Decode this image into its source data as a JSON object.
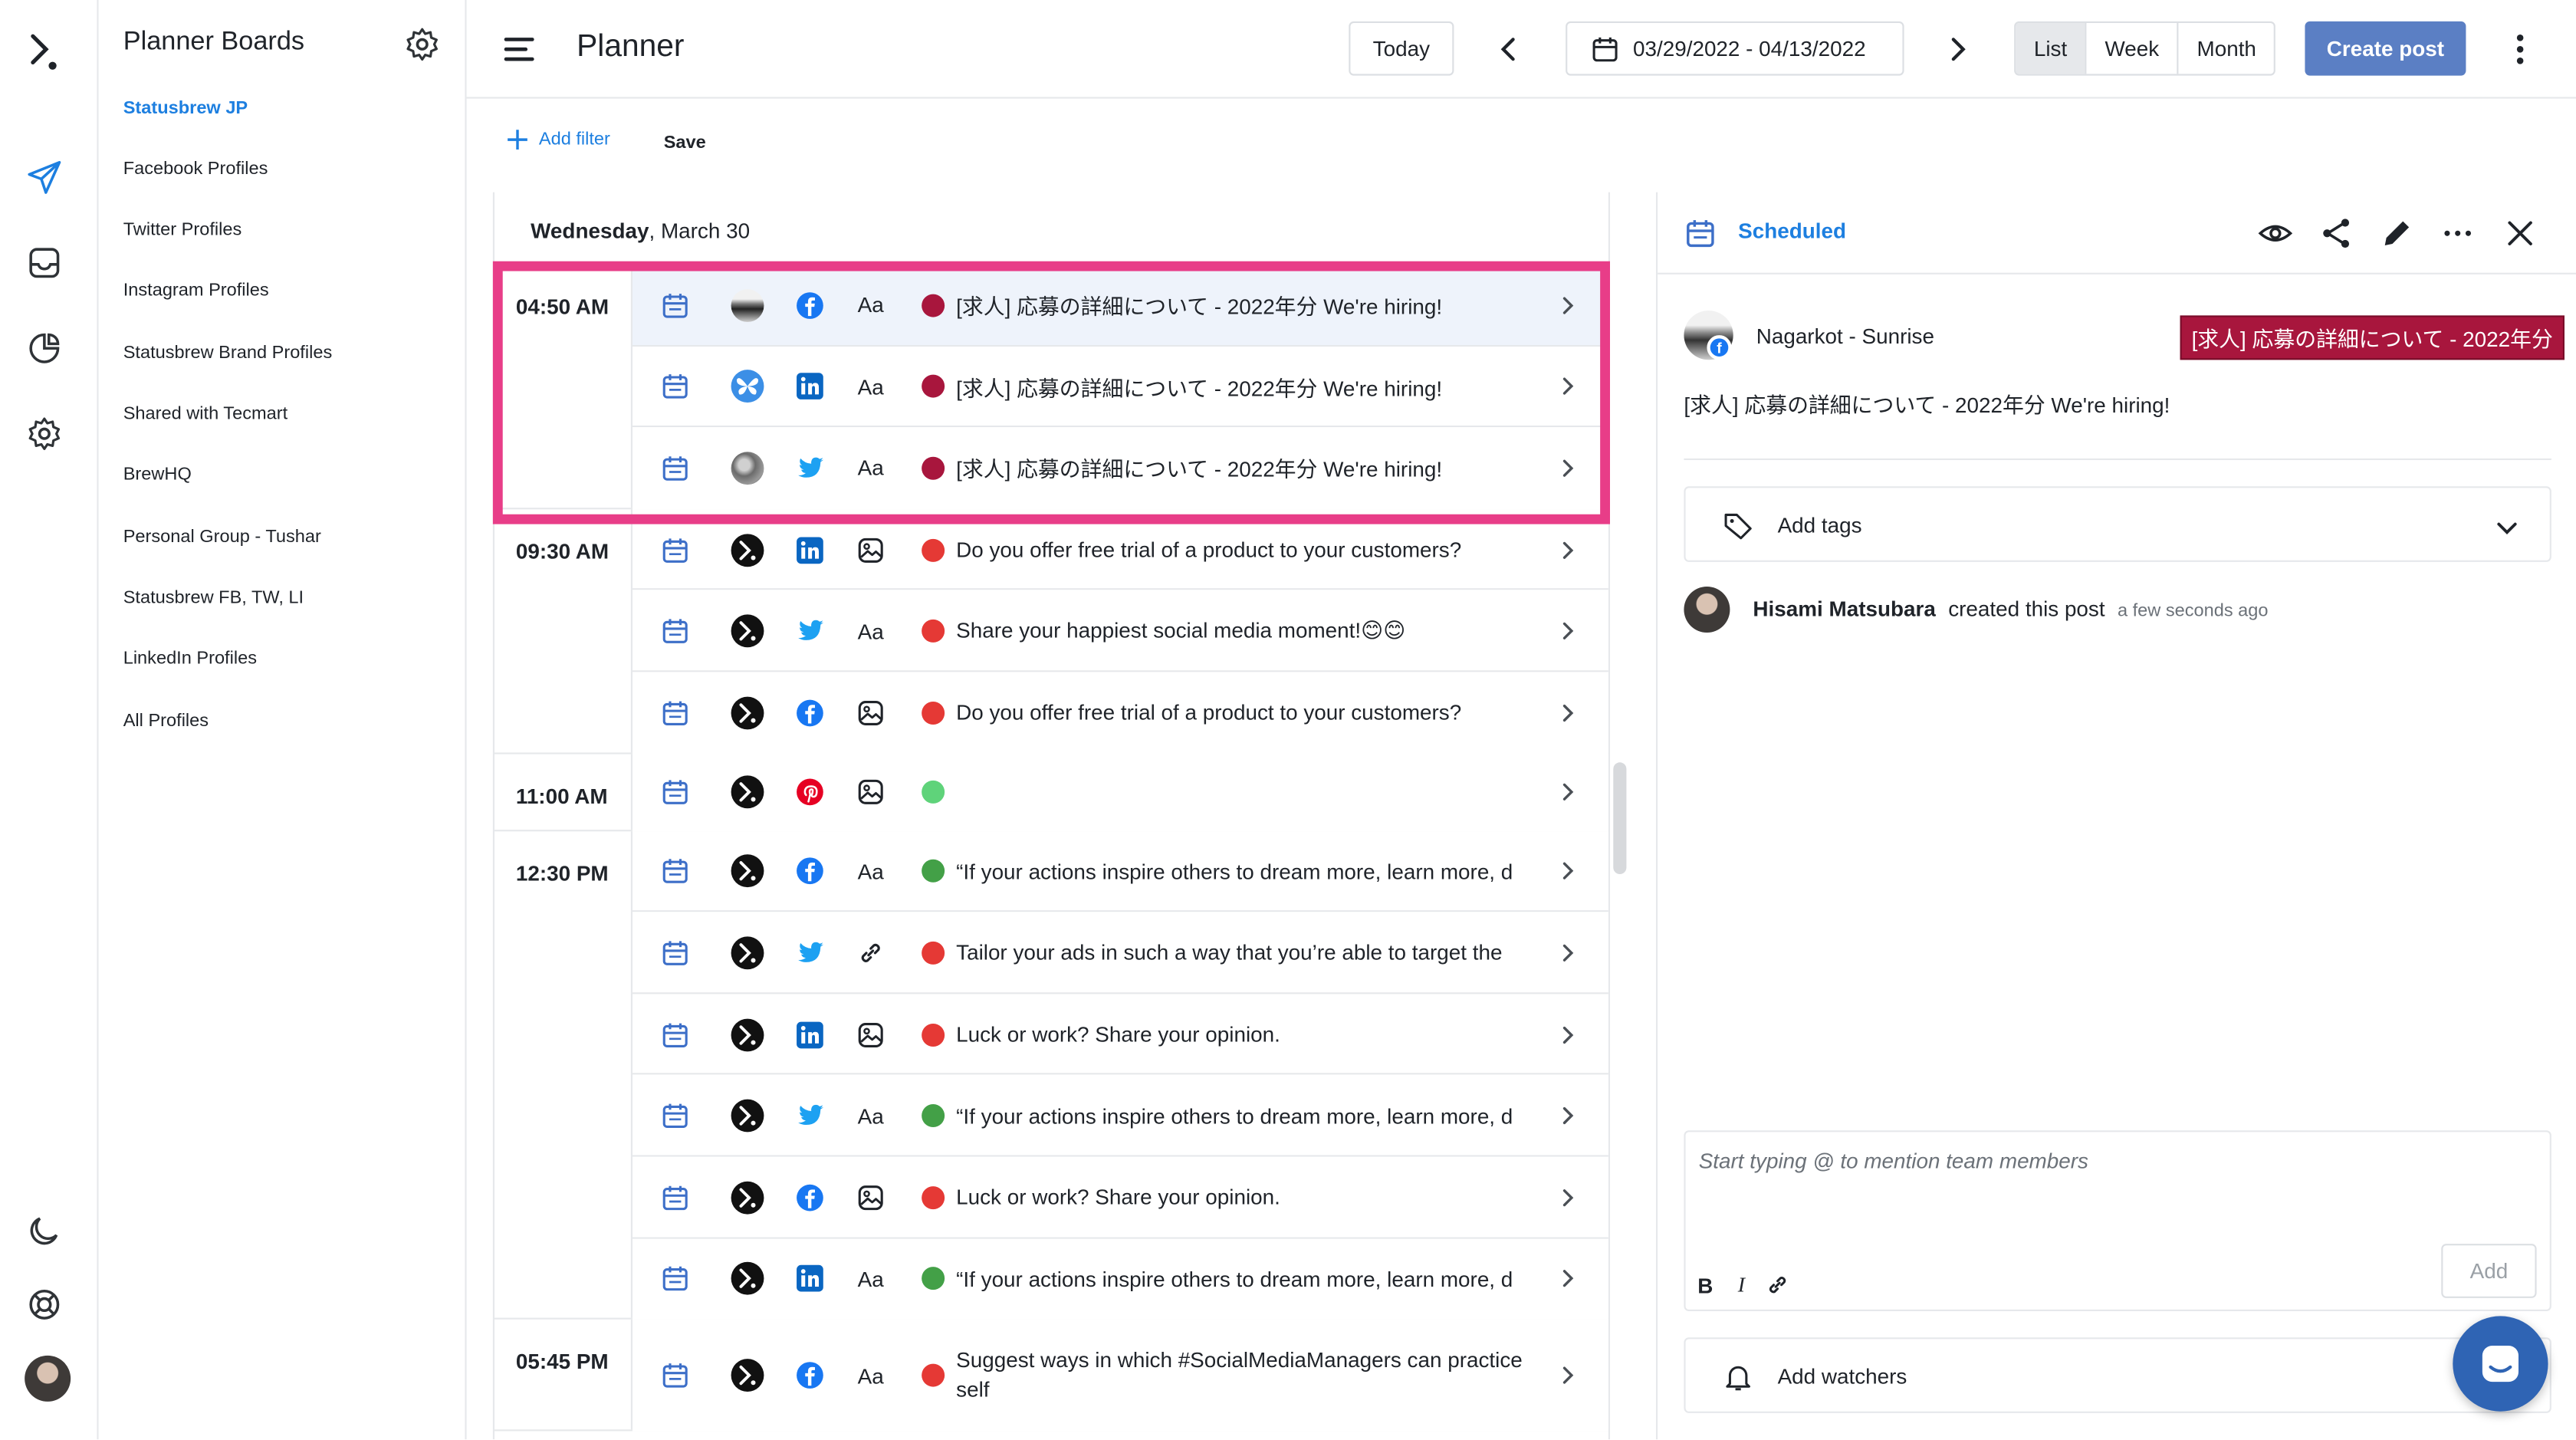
{
  "boards": {
    "title": "Planner Boards",
    "items": [
      {
        "label": "Statusbrew JP",
        "active": true
      },
      {
        "label": "Facebook Profiles"
      },
      {
        "label": "Twitter Profiles"
      },
      {
        "label": "Instagram Profiles"
      },
      {
        "label": "Statusbrew Brand Profiles"
      },
      {
        "label": "Shared with Tecmart"
      },
      {
        "label": "BrewHQ"
      },
      {
        "label": "Personal Group - Tushar"
      },
      {
        "label": "Statusbrew FB, TW, LI"
      },
      {
        "label": "LinkedIn Profiles"
      },
      {
        "label": "All Profiles"
      }
    ]
  },
  "header": {
    "title": "Planner",
    "today_label": "Today",
    "date_range": "03/29/2022 - 04/13/2022",
    "views": [
      "List",
      "Week",
      "Month"
    ],
    "active_view": "List",
    "create_label": "Create post"
  },
  "filters": {
    "add_filter_label": "Add filter",
    "save_label": "Save"
  },
  "day": {
    "weekday": "Wednesday",
    "date": ", March 30"
  },
  "groups": [
    {
      "time": "04:50 AM",
      "posts": [
        {
          "profile": "sunrise",
          "network": "facebook",
          "type": "text",
          "status": "#a8163d",
          "text": "[求人] 応募の詳細について - 2022年分 We're hiring!",
          "selected": true
        },
        {
          "profile": "butterfly",
          "network": "linkedin",
          "type": "text",
          "status": "#a8163d",
          "text": "[求人] 応募の詳細について - 2022年分 We're hiring!"
        },
        {
          "profile": "street",
          "network": "twitter",
          "type": "text",
          "status": "#a8163d",
          "text": "[求人] 応募の詳細について - 2022年分 We're hiring!"
        }
      ]
    },
    {
      "time": "09:30 AM",
      "posts": [
        {
          "profile": "brew",
          "network": "linkedin",
          "type": "image",
          "status": "#e53935",
          "text": "Do you offer free trial of a product to your customers?"
        },
        {
          "profile": "brew",
          "network": "twitter",
          "type": "text",
          "status": "#e53935",
          "text": "Share your happiest social media moment!😊😊"
        },
        {
          "profile": "brew",
          "network": "facebook",
          "type": "image",
          "status": "#e53935",
          "text": "Do you offer free trial of a product to your customers?"
        }
      ]
    },
    {
      "time": "11:00 AM",
      "posts": [
        {
          "profile": "brew",
          "network": "pinterest",
          "type": "image",
          "status": "#5fd37a",
          "text": ""
        }
      ]
    },
    {
      "time": "12:30 PM",
      "posts": [
        {
          "profile": "brew",
          "network": "facebook",
          "type": "text",
          "status": "#43a047",
          "text": "“If your actions inspire others to dream more, learn more, d"
        },
        {
          "profile": "brew",
          "network": "twitter",
          "type": "link",
          "status": "#e53935",
          "text": "Tailor your ads in such a way that you’re able to target the"
        },
        {
          "profile": "brew",
          "network": "linkedin",
          "type": "image",
          "status": "#e53935",
          "text": "Luck or work? Share your opinion."
        },
        {
          "profile": "brew",
          "network": "twitter",
          "type": "text",
          "status": "#43a047",
          "text": "“If your actions inspire others to dream more, learn more, d"
        },
        {
          "profile": "brew",
          "network": "facebook",
          "type": "image",
          "status": "#e53935",
          "text": "Luck or work? Share your opinion."
        },
        {
          "profile": "brew",
          "network": "linkedin",
          "type": "text",
          "status": "#43a047",
          "text": "“If your actions inspire others to dream more, learn more, d"
        }
      ]
    },
    {
      "time": "05:45 PM",
      "posts": [
        {
          "profile": "brew",
          "network": "facebook",
          "type": "text",
          "status": "#e53935",
          "text": "Suggest ways in which #SocialMediaManagers can practice self",
          "wrap": true
        }
      ]
    }
  ],
  "type_label_text": "Aa",
  "panel": {
    "status": "Scheduled",
    "profile_name": "Nagarkot - Sunrise",
    "tag_label": "[求人] 応募の詳細について - 2022年分",
    "body": "[求人] 応募の詳細について - 2022年分 We're hiring!",
    "add_tags_label": "Add tags",
    "activity": {
      "user": "Hisami Matsubara",
      "action": "created this post",
      "ago": "a few seconds ago"
    },
    "comment_placeholder": "Start typing @ to mention team members",
    "format_bold": "B",
    "format_italic": "I",
    "add_label": "Add",
    "watchers_label": "Add watchers"
  },
  "colors": {
    "accent": "#1d7fe0",
    "primary_button": "#5b7fc4",
    "highlight": "#e83d88",
    "facebook": "#1877f2",
    "linkedin": "#0a66c2",
    "twitter": "#1da1f2",
    "pinterest": "#e60023"
  }
}
